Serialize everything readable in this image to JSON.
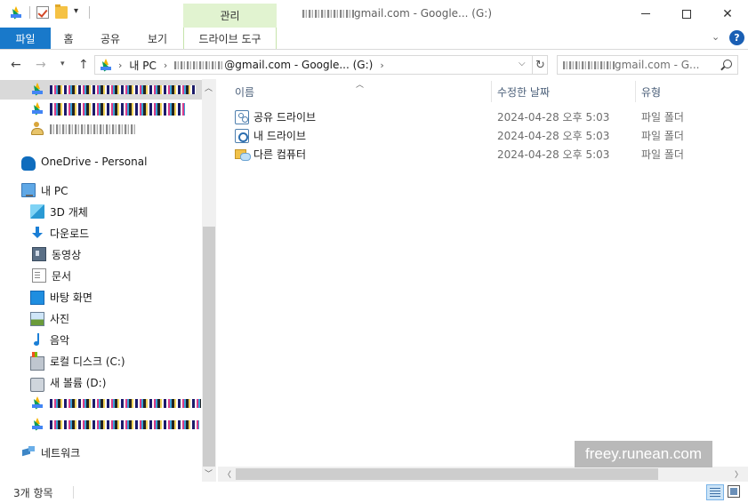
{
  "titlebar": {
    "context_tab": "관리",
    "title_suffix": "gmail.com - Google... (G:)",
    "minimize": "─",
    "maximize": "☐",
    "close": "✕"
  },
  "ribbon": {
    "tabs": [
      "파일",
      "홈",
      "공유",
      "보기",
      "드라이브 도구"
    ]
  },
  "address": {
    "crumb_pc": "내 PC",
    "crumb_drive": "@gmail.com - Google... (G:)",
    "search_placeholder_suffix": "gmail.com - G..."
  },
  "nav": {
    "onedrive": "OneDrive - Personal",
    "this_pc": "내 PC",
    "items": [
      "3D 개체",
      "다운로드",
      "동영상",
      "문서",
      "바탕 화면",
      "사진",
      "음악",
      "로컬 디스크 (C:)",
      "새 볼륨 (D:)"
    ],
    "network": "네트워크"
  },
  "columns": {
    "name": "이름",
    "date": "수정한 날짜",
    "type": "유형"
  },
  "files": [
    {
      "name": "공유 드라이브",
      "date": "2024-04-28 오후 5:03",
      "type": "파일 폴더",
      "icon": "shared-drive-icon"
    },
    {
      "name": "내 드라이브",
      "date": "2024-04-28 오후 5:03",
      "type": "파일 폴더",
      "icon": "my-drive-icon"
    },
    {
      "name": "다른 컴퓨터",
      "date": "2024-04-28 오후 5:03",
      "type": "파일 폴더",
      "icon": "other-computers-icon"
    }
  ],
  "status": {
    "count": "3개 항목"
  },
  "watermark": "freey.runean.com",
  "colors": {
    "file_tab": "#1979ca",
    "context_tab": "#e1f3d0",
    "selection": "#d9d9d9"
  }
}
